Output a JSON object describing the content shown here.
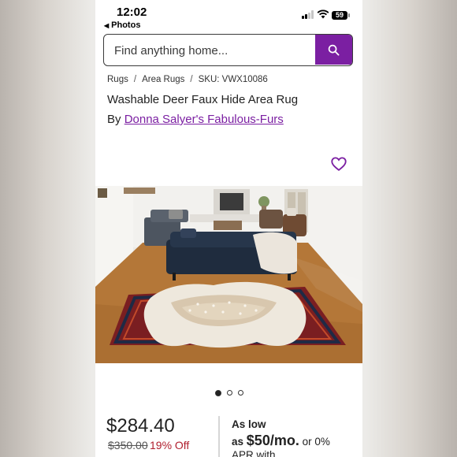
{
  "status_bar": {
    "time": "12:02",
    "back_label": "Photos",
    "battery": "59"
  },
  "search": {
    "placeholder": "Find anything home..."
  },
  "breadcrumb": {
    "items": [
      "Rugs",
      "Area Rugs"
    ],
    "sku": "SKU: VWX10086"
  },
  "product": {
    "title": "Washable Deer Faux Hide Area Rug",
    "by_prefix": "By",
    "brand": "Donna Salyer's Fabulous-Furs"
  },
  "gallery": {
    "total_images": 3,
    "active_index": 0
  },
  "pricing": {
    "price": "$284.40",
    "original_price": "$350.00",
    "discount": "19% Off",
    "financing_as_low": "As low",
    "financing_as": "as",
    "financing_amount": "$50/mo.",
    "financing_or": "or 0%",
    "financing_apr": "APR with"
  },
  "colors": {
    "brand_purple": "#7b1fa2",
    "sale_red": "#b01e2d"
  }
}
